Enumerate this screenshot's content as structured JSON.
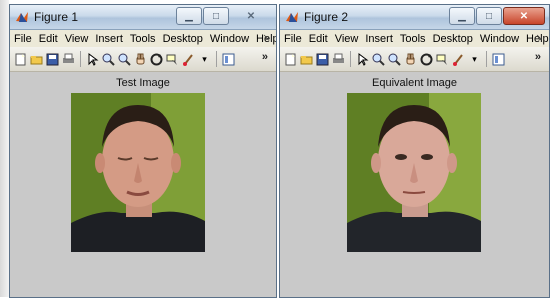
{
  "windows": [
    {
      "title": "Figure 1",
      "menu": [
        "File",
        "Edit",
        "View",
        "Insert",
        "Tools",
        "Desktop",
        "Window",
        "Help"
      ],
      "axes_title": "Test Image"
    },
    {
      "title": "Figure 2",
      "menu": [
        "File",
        "Edit",
        "View",
        "Insert",
        "Tools",
        "Desktop",
        "Window",
        "Help"
      ],
      "axes_title": "Equivalent Image"
    }
  ],
  "toolbar_icons": [
    "new-file-icon",
    "open-folder-icon",
    "save-icon",
    "print-icon",
    "pointer-icon",
    "zoom-in-icon",
    "zoom-out-icon",
    "pan-hand-icon",
    "rotate-3d-icon",
    "data-cursor-icon",
    "brush-icon",
    "dropdown-arrow-icon",
    "insert-colorbar-icon",
    "more-icon"
  ],
  "colors": {
    "title_gradient_top": "#e8f0f8",
    "title_gradient_bottom": "#aec4dc",
    "figure_background": "#c9c9c9",
    "image_background": "#6f8f2c",
    "close_button": "#c8452b"
  }
}
